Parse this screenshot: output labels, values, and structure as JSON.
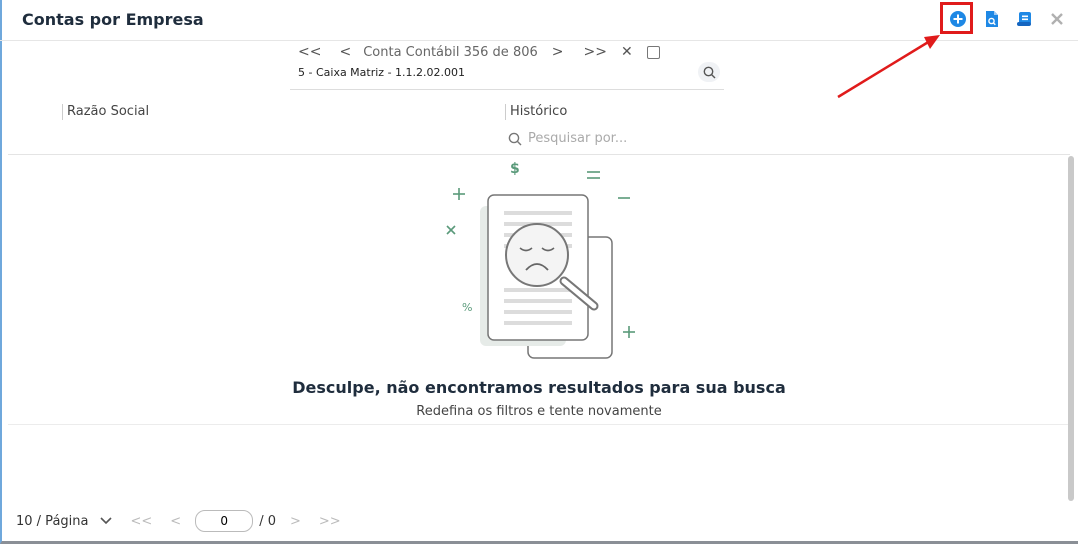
{
  "window": {
    "title": "Contas por Empresa"
  },
  "header": {
    "icons": [
      "add-circle-icon",
      "document-search-icon",
      "scroll-icon",
      "close-icon"
    ]
  },
  "navigator": {
    "first": "<<",
    "prev": "<",
    "label": "Conta Contábil 356 de 806",
    "next": ">",
    "last": ">>",
    "clear": "✕",
    "account": "5 - Caixa Matriz  - 1.1.2.02.001"
  },
  "table": {
    "columns": [
      "Razão Social",
      "Histórico"
    ],
    "search_placeholder": "Pesquisar por..."
  },
  "empty": {
    "title": "Desculpe, não encontramos resultados para sua busca",
    "subtitle": "Redefina os filtros e tente novamente"
  },
  "footer": {
    "page_size": "10 / Página",
    "page_value": "0",
    "total_pages": "/ 0",
    "first": "<<",
    "prev": "<",
    "next": ">",
    "last": ">>"
  },
  "colors": {
    "accent": "#1e88e5",
    "highlight": "#e01b1b",
    "illustration": "#5a9a7a"
  }
}
